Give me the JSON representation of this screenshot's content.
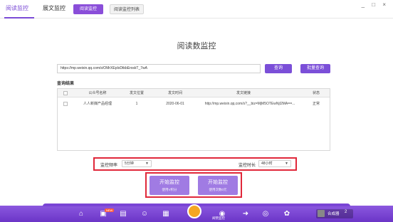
{
  "topbar": {
    "tabs": [
      "阅读监控",
      "展文监控"
    ],
    "subtabs": [
      "阅读监控",
      "阅读监控列表"
    ],
    "window_controls": "_ □ ×"
  },
  "page": {
    "title": "阅读数监控"
  },
  "search": {
    "url_value": "https://mp.weixin.qq.com/s/OMrXEpIxDtkbEroskT_7wA",
    "query_label": "查询",
    "batch_label": "批量查询"
  },
  "results": {
    "title": "查询结果",
    "columns": [
      "",
      "公众号名称",
      "发文位置",
      "发文时间",
      "发文链接",
      "状态"
    ],
    "rows": [
      {
        "name": "人人新媒产品经理",
        "position": "1",
        "time": "2020-06-01",
        "link": "http://mp.weixin.qq.com/s?__biz=MjM5OTEwNjI2MA==...",
        "status": "正常"
      }
    ]
  },
  "config": {
    "freq_label": "监控频率",
    "freq_value": "5分钟",
    "duration_label": "监控时长",
    "duration_value": "48小时"
  },
  "actions": [
    {
      "title": "开始监控",
      "sub": "使用V积分"
    },
    {
      "title": "开始监控",
      "sub": "使用次数0元"
    }
  ],
  "bottombar": {
    "badge": "NEW",
    "center_label": "阅赞监控",
    "user_name": "合成器",
    "user_level": "2"
  }
}
